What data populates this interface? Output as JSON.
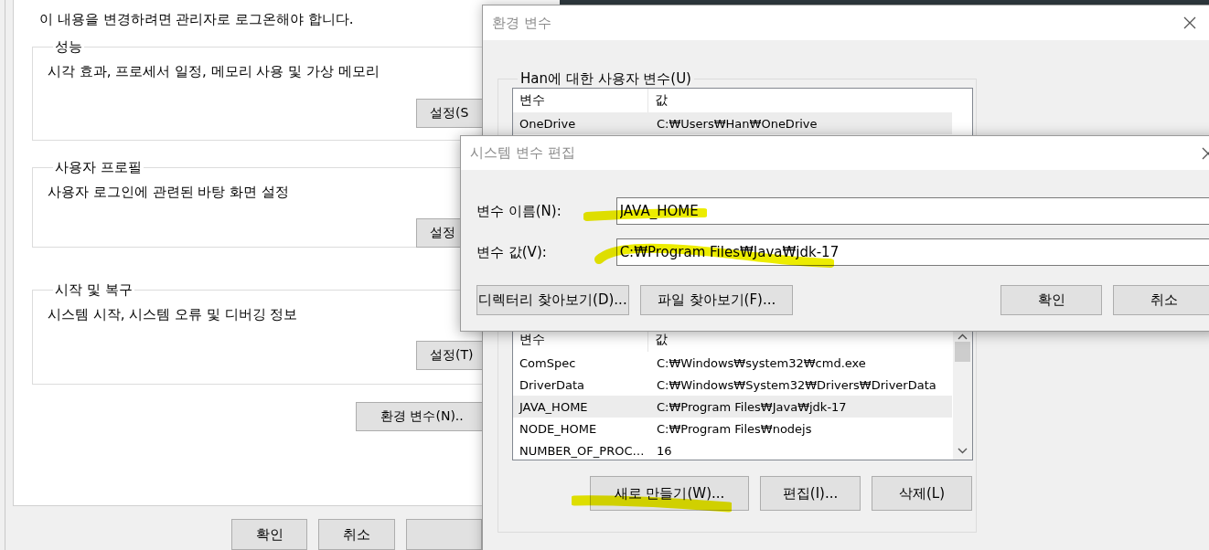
{
  "system_properties": {
    "notice": "이 내용을 변경하려면 관리자로 로그온해야 합니다.",
    "groups": [
      {
        "legend": "성능",
        "description": "시각 효과, 프로세서 일정, 메모리 사용 및 가상 메모리",
        "button": "설정(S"
      },
      {
        "legend": "사용자 프로필",
        "description": "사용자 로그인에 관련된 바탕 화면 설정",
        "button": "설정"
      },
      {
        "legend": "시작 및 복구",
        "description": "시스템 시작, 시스템 오류 및 디버깅 정보",
        "button": "설정(T)"
      }
    ],
    "env_button": "환경 변수(N)..",
    "footer_buttons": [
      "확인",
      "취소"
    ]
  },
  "env_window": {
    "title": "환경 변수",
    "user_group": {
      "legend": "Han에 대한 사용자 변수(U)",
      "columns": [
        "변수",
        "값"
      ],
      "rows": [
        {
          "name": "OneDrive",
          "value": "C:₩Users₩Han₩OneDrive",
          "selected": true
        }
      ]
    },
    "system_group": {
      "columns": [
        "변수",
        "값"
      ],
      "rows": [
        {
          "name": "ComSpec",
          "value": "C:₩Windows₩system32₩cmd.exe",
          "selected": false
        },
        {
          "name": "DriverData",
          "value": "C:₩Windows₩System32₩Drivers₩DriverData",
          "selected": false
        },
        {
          "name": "JAVA_HOME",
          "value": "C:₩Program Files₩Java₩jdk-17",
          "selected": true
        },
        {
          "name": "NODE_HOME",
          "value": "C:₩Program Files₩nodejs",
          "selected": false
        },
        {
          "name": "NUMBER_OF_PROC…",
          "value": "16",
          "selected": false
        }
      ],
      "buttons": [
        "새로 만들기(W)...",
        "편집(I)...",
        "삭제(L)"
      ]
    }
  },
  "edit_dialog": {
    "title": "시스템 변수 편집",
    "fields": [
      {
        "label": "변수 이름(N):",
        "value": "JAVA_HOME"
      },
      {
        "label": "변수 값(V):",
        "value": "C:₩Program Files₩Java₩jdk-17"
      }
    ],
    "left_buttons": [
      "디렉터리 찾아보기(D)...",
      "파일 찾아보기(F)..."
    ],
    "right_buttons": [
      "확인",
      "취소"
    ]
  }
}
